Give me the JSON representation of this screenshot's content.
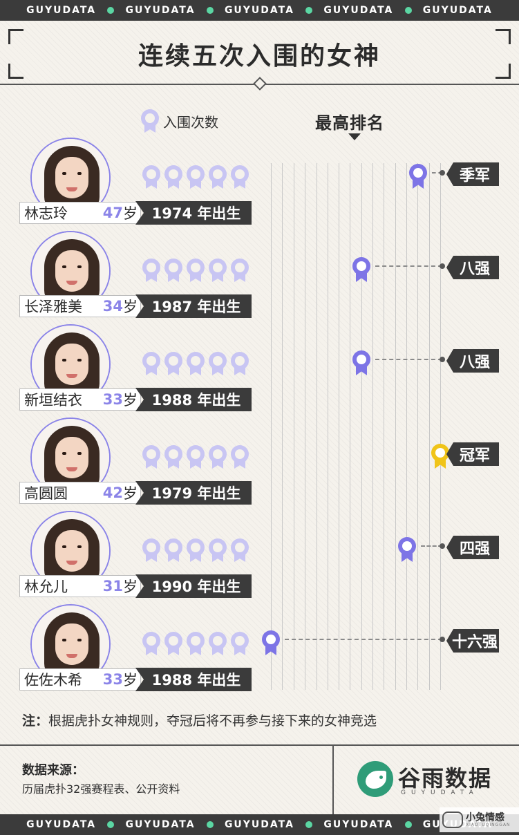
{
  "band": {
    "text": "GUYUDATA",
    "accent": "#5bd6a3",
    "bg": "#3b3b3b"
  },
  "title": "连续五次入围的女神",
  "legend": {
    "label": "入围次数",
    "icon": "medal-icon"
  },
  "best_rank_label": "最高排名",
  "colors": {
    "accent": "#7d74e6",
    "medal_light": "#c8c5f3",
    "gold": "#f0c419",
    "dark": "#3b3b3b"
  },
  "people": [
    {
      "name": "林志玲",
      "age": "47",
      "sui": "岁",
      "birth": "1974 年出生",
      "rank": "季军",
      "rank_level": 4,
      "gold": false,
      "appearances": 5,
      "shirt": "#f4e7e1"
    },
    {
      "name": "长泽雅美",
      "age": "34",
      "sui": "岁",
      "birth": "1987 年出生",
      "rank": "八强",
      "rank_level": 0,
      "gold": false,
      "appearances": 5,
      "shirt": "#f4ece5"
    },
    {
      "name": "新垣结衣",
      "age": "33",
      "sui": "岁",
      "birth": "1988 年出生",
      "rank": "八强",
      "rank_level": 0,
      "gold": false,
      "appearances": 5,
      "shirt": "#ffffff"
    },
    {
      "name": "高圆圆",
      "age": "42",
      "sui": "岁",
      "birth": "1979 年出生",
      "rank": "冠军",
      "rank_level": 5,
      "gold": true,
      "appearances": 5,
      "shirt": "#2f4fb0"
    },
    {
      "name": "林允儿",
      "age": "31",
      "sui": "岁",
      "birth": "1990 年出生",
      "rank": "四强",
      "rank_level": 3,
      "gold": false,
      "appearances": 5,
      "shirt": "#d8cfc6"
    },
    {
      "name": "佐佐木希",
      "age": "33",
      "sui": "岁",
      "birth": "1988 年出生",
      "rank": "十六强",
      "rank_level": -1,
      "gold": false,
      "appearances": 5,
      "shirt": "#e9e2dc"
    }
  ],
  "note": {
    "prefix": "注：",
    "text": "根据虎扑女神规则，夺冠后将不再参与接下来的女神竞选"
  },
  "source": {
    "title": "数据来源：",
    "text": "历届虎扑32强赛程表、公开资料"
  },
  "brand": {
    "name": "谷雨数据",
    "sub": "GUYUDATA",
    "logo": "bird-logo-icon"
  },
  "watermark": {
    "title": "小兔情感",
    "sub": "XIAOTUQINGGAN"
  }
}
